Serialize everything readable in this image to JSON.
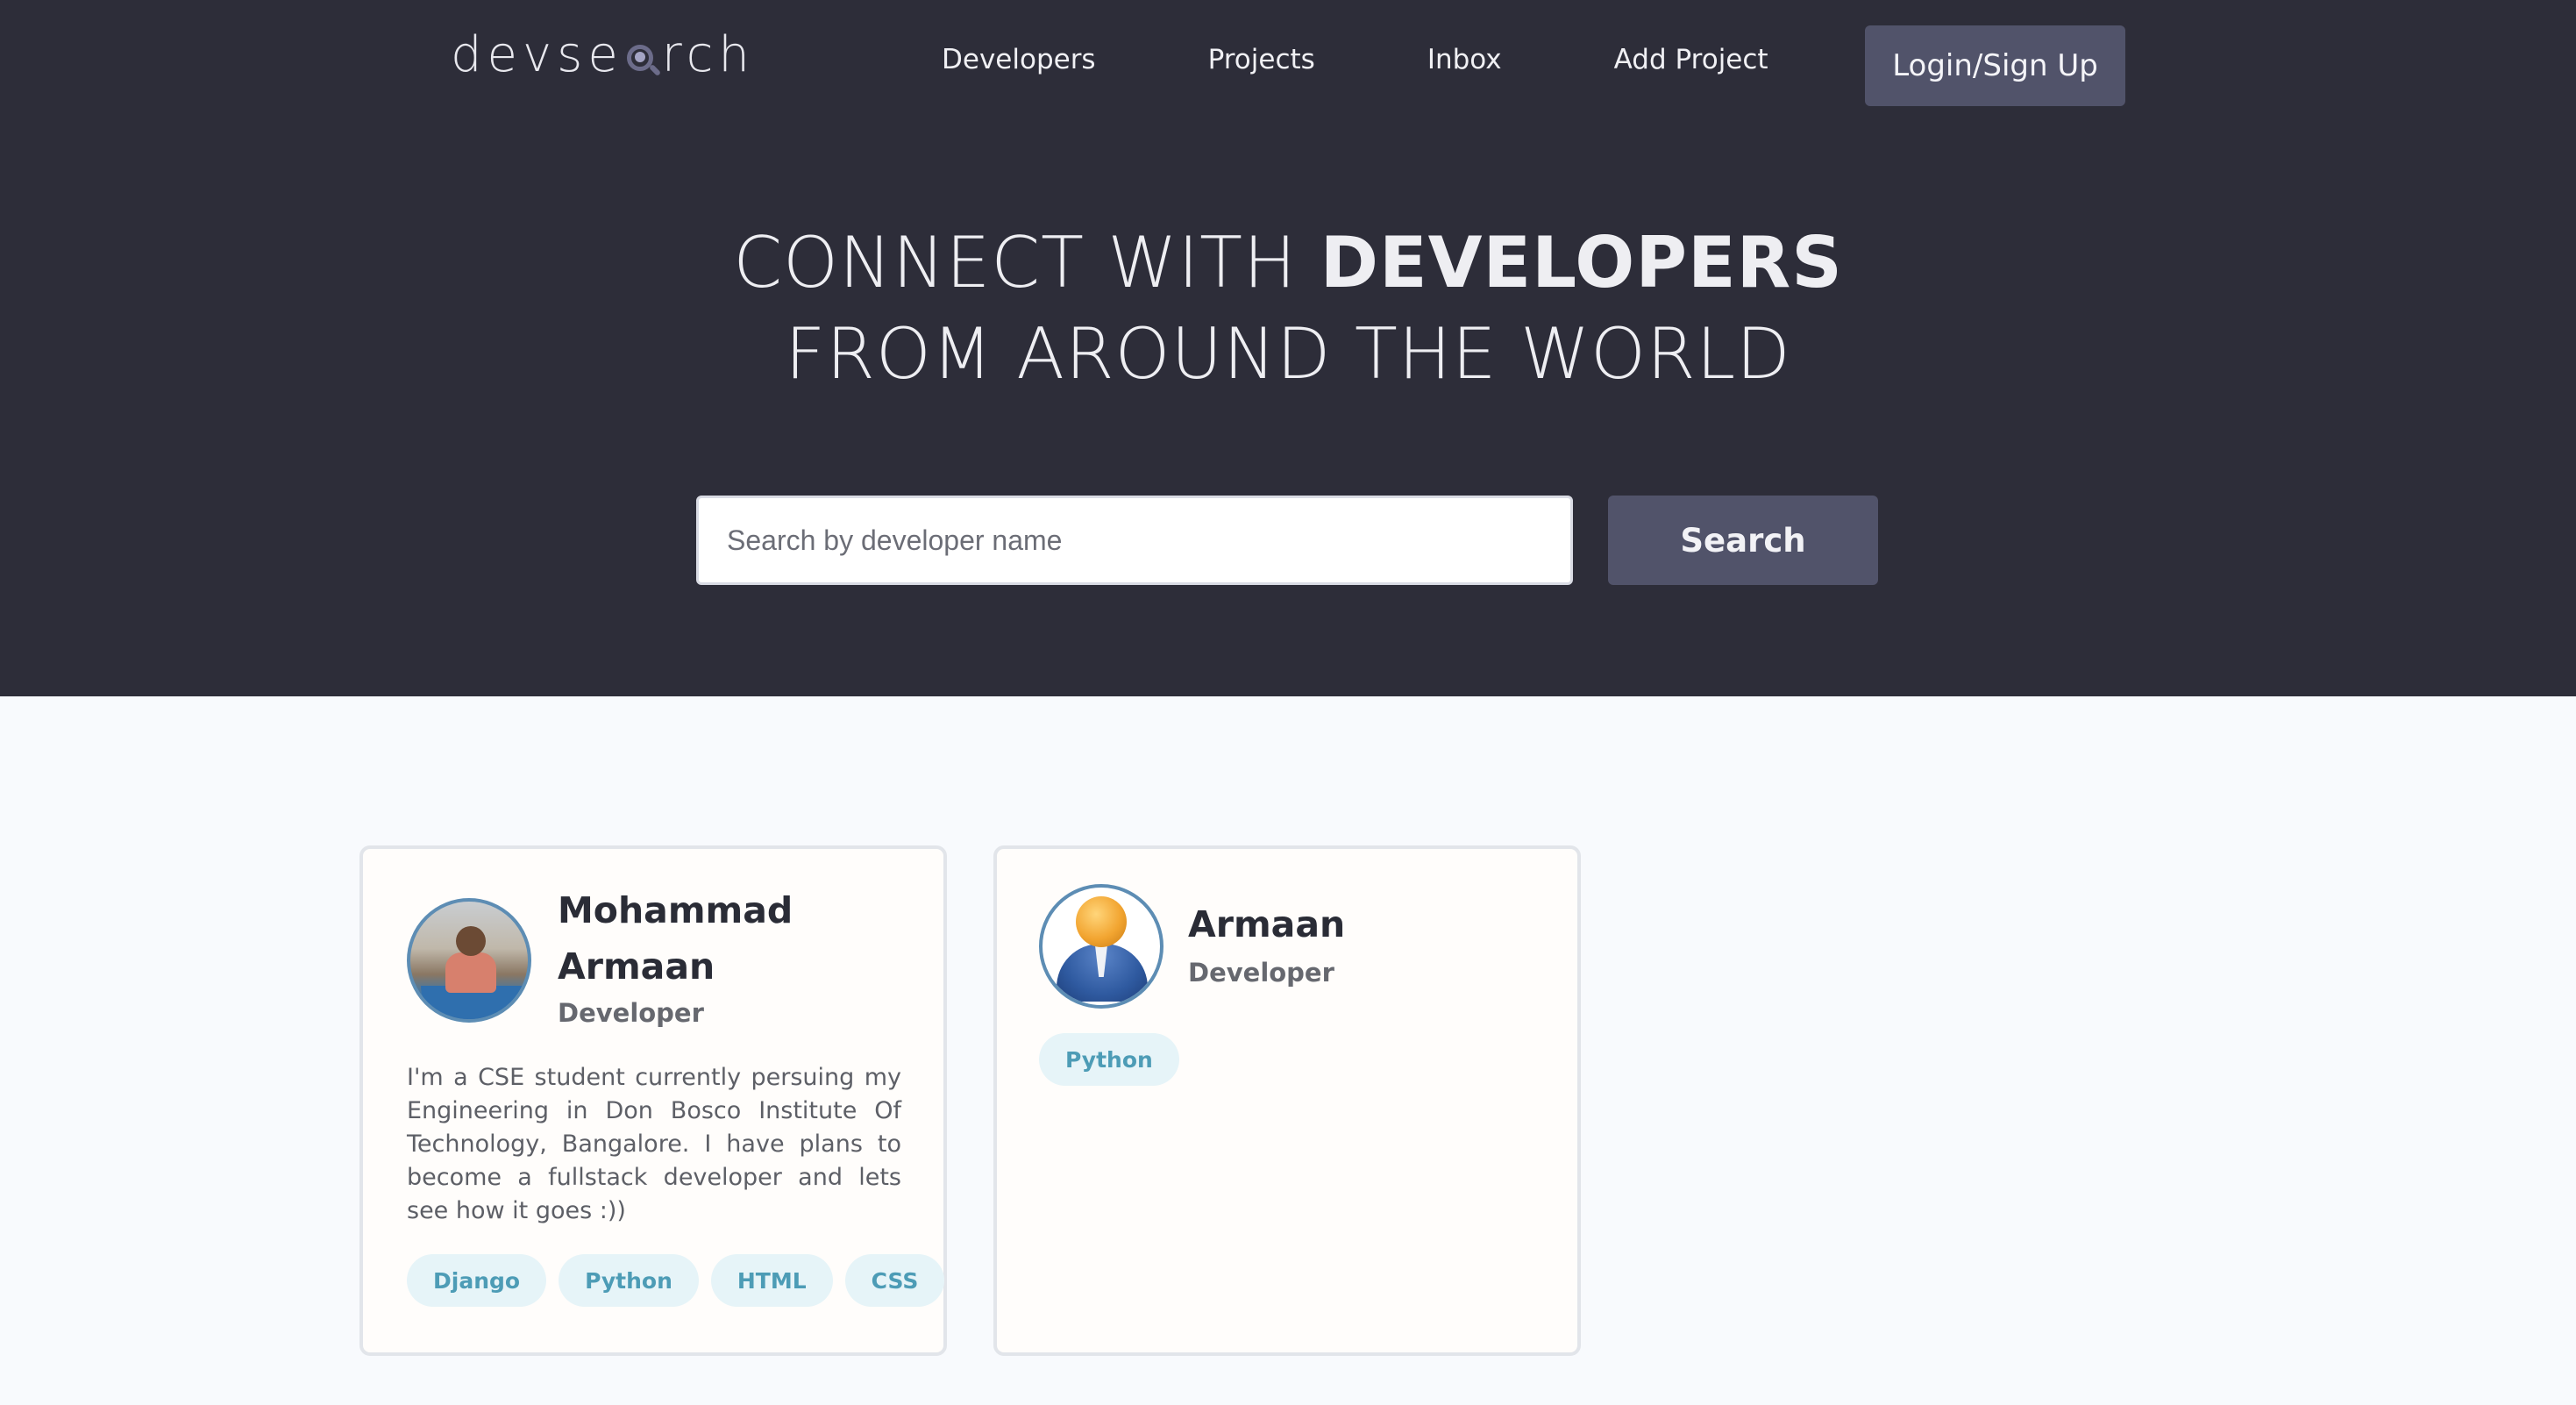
{
  "header": {
    "logo_text_start": "devse",
    "logo_text_end": "rch",
    "nav": [
      "Developers",
      "Projects",
      "Inbox",
      "Add Project"
    ],
    "login_label": "Login/Sign Up"
  },
  "hero": {
    "line1_light": "CONNECT WITH ",
    "line1_bold": "DEVELOPERS",
    "line2": "FROM AROUND THE WORLD"
  },
  "search": {
    "placeholder": "Search by developer name",
    "button_label": "Search"
  },
  "developers": [
    {
      "name": "Mohammad Armaan",
      "role": "Developer",
      "bio": "I'm a CSE student currently persuing my Engineering in Don Bosco Institute Of Technology, Bangalore. I have plans to become a fullstack developer and lets see how it goes :))",
      "tags": [
        "Django",
        "Python",
        "HTML",
        "CSS"
      ]
    },
    {
      "name": "Armaan",
      "role": "Developer",
      "bio": "",
      "tags": [
        "Python"
      ]
    }
  ],
  "colors": {
    "header_bg": "#2d2d39",
    "button_bg": "#51536a",
    "page_bg": "#f8fafd",
    "tag_bg": "#e6f4f8",
    "tag_text": "#4d9cb6"
  }
}
